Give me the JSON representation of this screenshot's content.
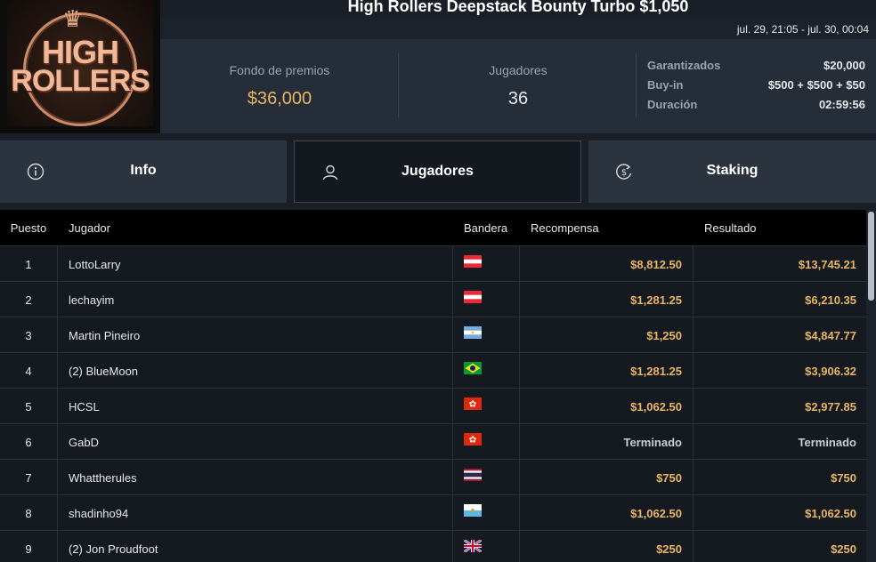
{
  "tournament": {
    "title": "High Rollers Deepstack Bounty Turbo $1,050",
    "dates": "jul. 29, 21:05 - jul. 30, 00:04",
    "logo_line1": "HIGH",
    "logo_line2": "ROLLERS"
  },
  "stats": {
    "prize_label": "Fondo de premios",
    "prize_value": "$36,000",
    "players_label": "Jugadores",
    "players_value": "36",
    "details": [
      {
        "label": "Garantizados",
        "value": "$20,000"
      },
      {
        "label": "Buy-in",
        "value": "$500 + $500 + $50"
      },
      {
        "label": "Duración",
        "value": "02:59:56"
      }
    ]
  },
  "tabs": [
    {
      "label": "Info",
      "icon": "info-icon"
    },
    {
      "label": "Jugadores",
      "icon": "user-icon",
      "active": true
    },
    {
      "label": "Staking",
      "icon": "staking-dollar-icon"
    }
  ],
  "table": {
    "headers": {
      "position": "Puesto",
      "player": "Jugador",
      "flag": "Bandera",
      "bounty": "Recompensa",
      "result": "Resultado"
    },
    "rows": [
      {
        "position": "1",
        "player": "LottoLarry",
        "flag": "austria-flag",
        "bounty": "$8,812.50",
        "result": "$13,745.21"
      },
      {
        "position": "2",
        "player": "lechayim",
        "flag": "austria-flag",
        "bounty": "$1,281.25",
        "result": "$6,210.35"
      },
      {
        "position": "3",
        "player": "Martin Pineiro",
        "flag": "argentina-flag",
        "bounty": "$1,250",
        "result": "$4,847.77"
      },
      {
        "position": "4",
        "player": "(2) BlueMoon",
        "flag": "brazil-flag",
        "bounty": "$1,281.25",
        "result": "$3,906.32"
      },
      {
        "position": "5",
        "player": "HCSL",
        "flag": "hong-kong-flag",
        "bounty": "$1,062.50",
        "result": "$2,977.85"
      },
      {
        "position": "6",
        "player": "GabD",
        "flag": "hong-kong-flag",
        "bounty": "Terminado",
        "result": "Terminado"
      },
      {
        "position": "7",
        "player": "Whattherules",
        "flag": "thailand-flag",
        "bounty": "$750",
        "result": "$750"
      },
      {
        "position": "8",
        "player": "shadinho94",
        "flag": "san-marino-flag",
        "bounty": "$1,062.50",
        "result": "$1,062.50"
      },
      {
        "position": "9",
        "player": "(2) Jon Proudfoot",
        "flag": "uk-flag",
        "bounty": "$250",
        "result": "$250"
      }
    ]
  },
  "colors": {
    "accent_gold": "#e8b565",
    "panel": "#252d39",
    "background": "#1a1f27"
  }
}
